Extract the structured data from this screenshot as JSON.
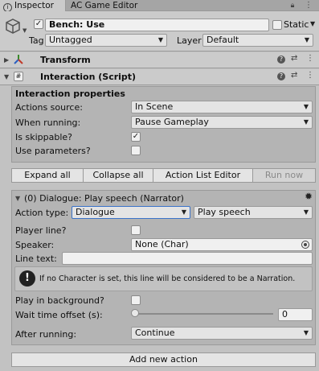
{
  "tabs": [
    {
      "label": "Inspector",
      "icon": "info-icon"
    },
    {
      "label": "AC Game Editor"
    }
  ],
  "header": {
    "object_name": "Bench: Use",
    "active_checked": true,
    "static_label": "Static",
    "tag_label": "Tag",
    "tag_value": "Untagged",
    "layer_label": "Layer",
    "layer_value": "Default"
  },
  "components": [
    {
      "name": "Transform"
    },
    {
      "name": "Interaction (Script)"
    }
  ],
  "interaction_properties": {
    "title": "Interaction properties",
    "rows": [
      {
        "label": "Actions source:",
        "value": "In Scene"
      },
      {
        "label": "When running:",
        "value": "Pause Gameplay"
      }
    ],
    "skippable_label": "Is skippable?",
    "skippable_checked": true,
    "use_parameters_label": "Use parameters?",
    "use_parameters_checked": false
  },
  "toolbar": {
    "expand_all": "Expand all",
    "collapse_all": "Collapse all",
    "action_list_editor": "Action List Editor",
    "run_now": "Run now"
  },
  "action": {
    "title": "(0) Dialogue: Play speech (Narrator)",
    "type_label": "Action type:",
    "type_category": "Dialogue",
    "type_subtype": "Play speech",
    "player_line_label": "Player line?",
    "player_line_checked": false,
    "speaker_label": "Speaker:",
    "speaker_value": "None (Char)",
    "line_text_label": "Line text:",
    "line_text_value": "",
    "info_message": "If no Character is set, this line will be considered to be a Narration.",
    "play_in_background_label": "Play in background?",
    "play_in_background_checked": false,
    "wait_time_label": "Wait time offset (s):",
    "wait_time_value": "0",
    "wait_time_fraction": 0,
    "after_running_label": "After running:",
    "after_running_value": "Continue"
  },
  "add_action_label": "Add new action"
}
